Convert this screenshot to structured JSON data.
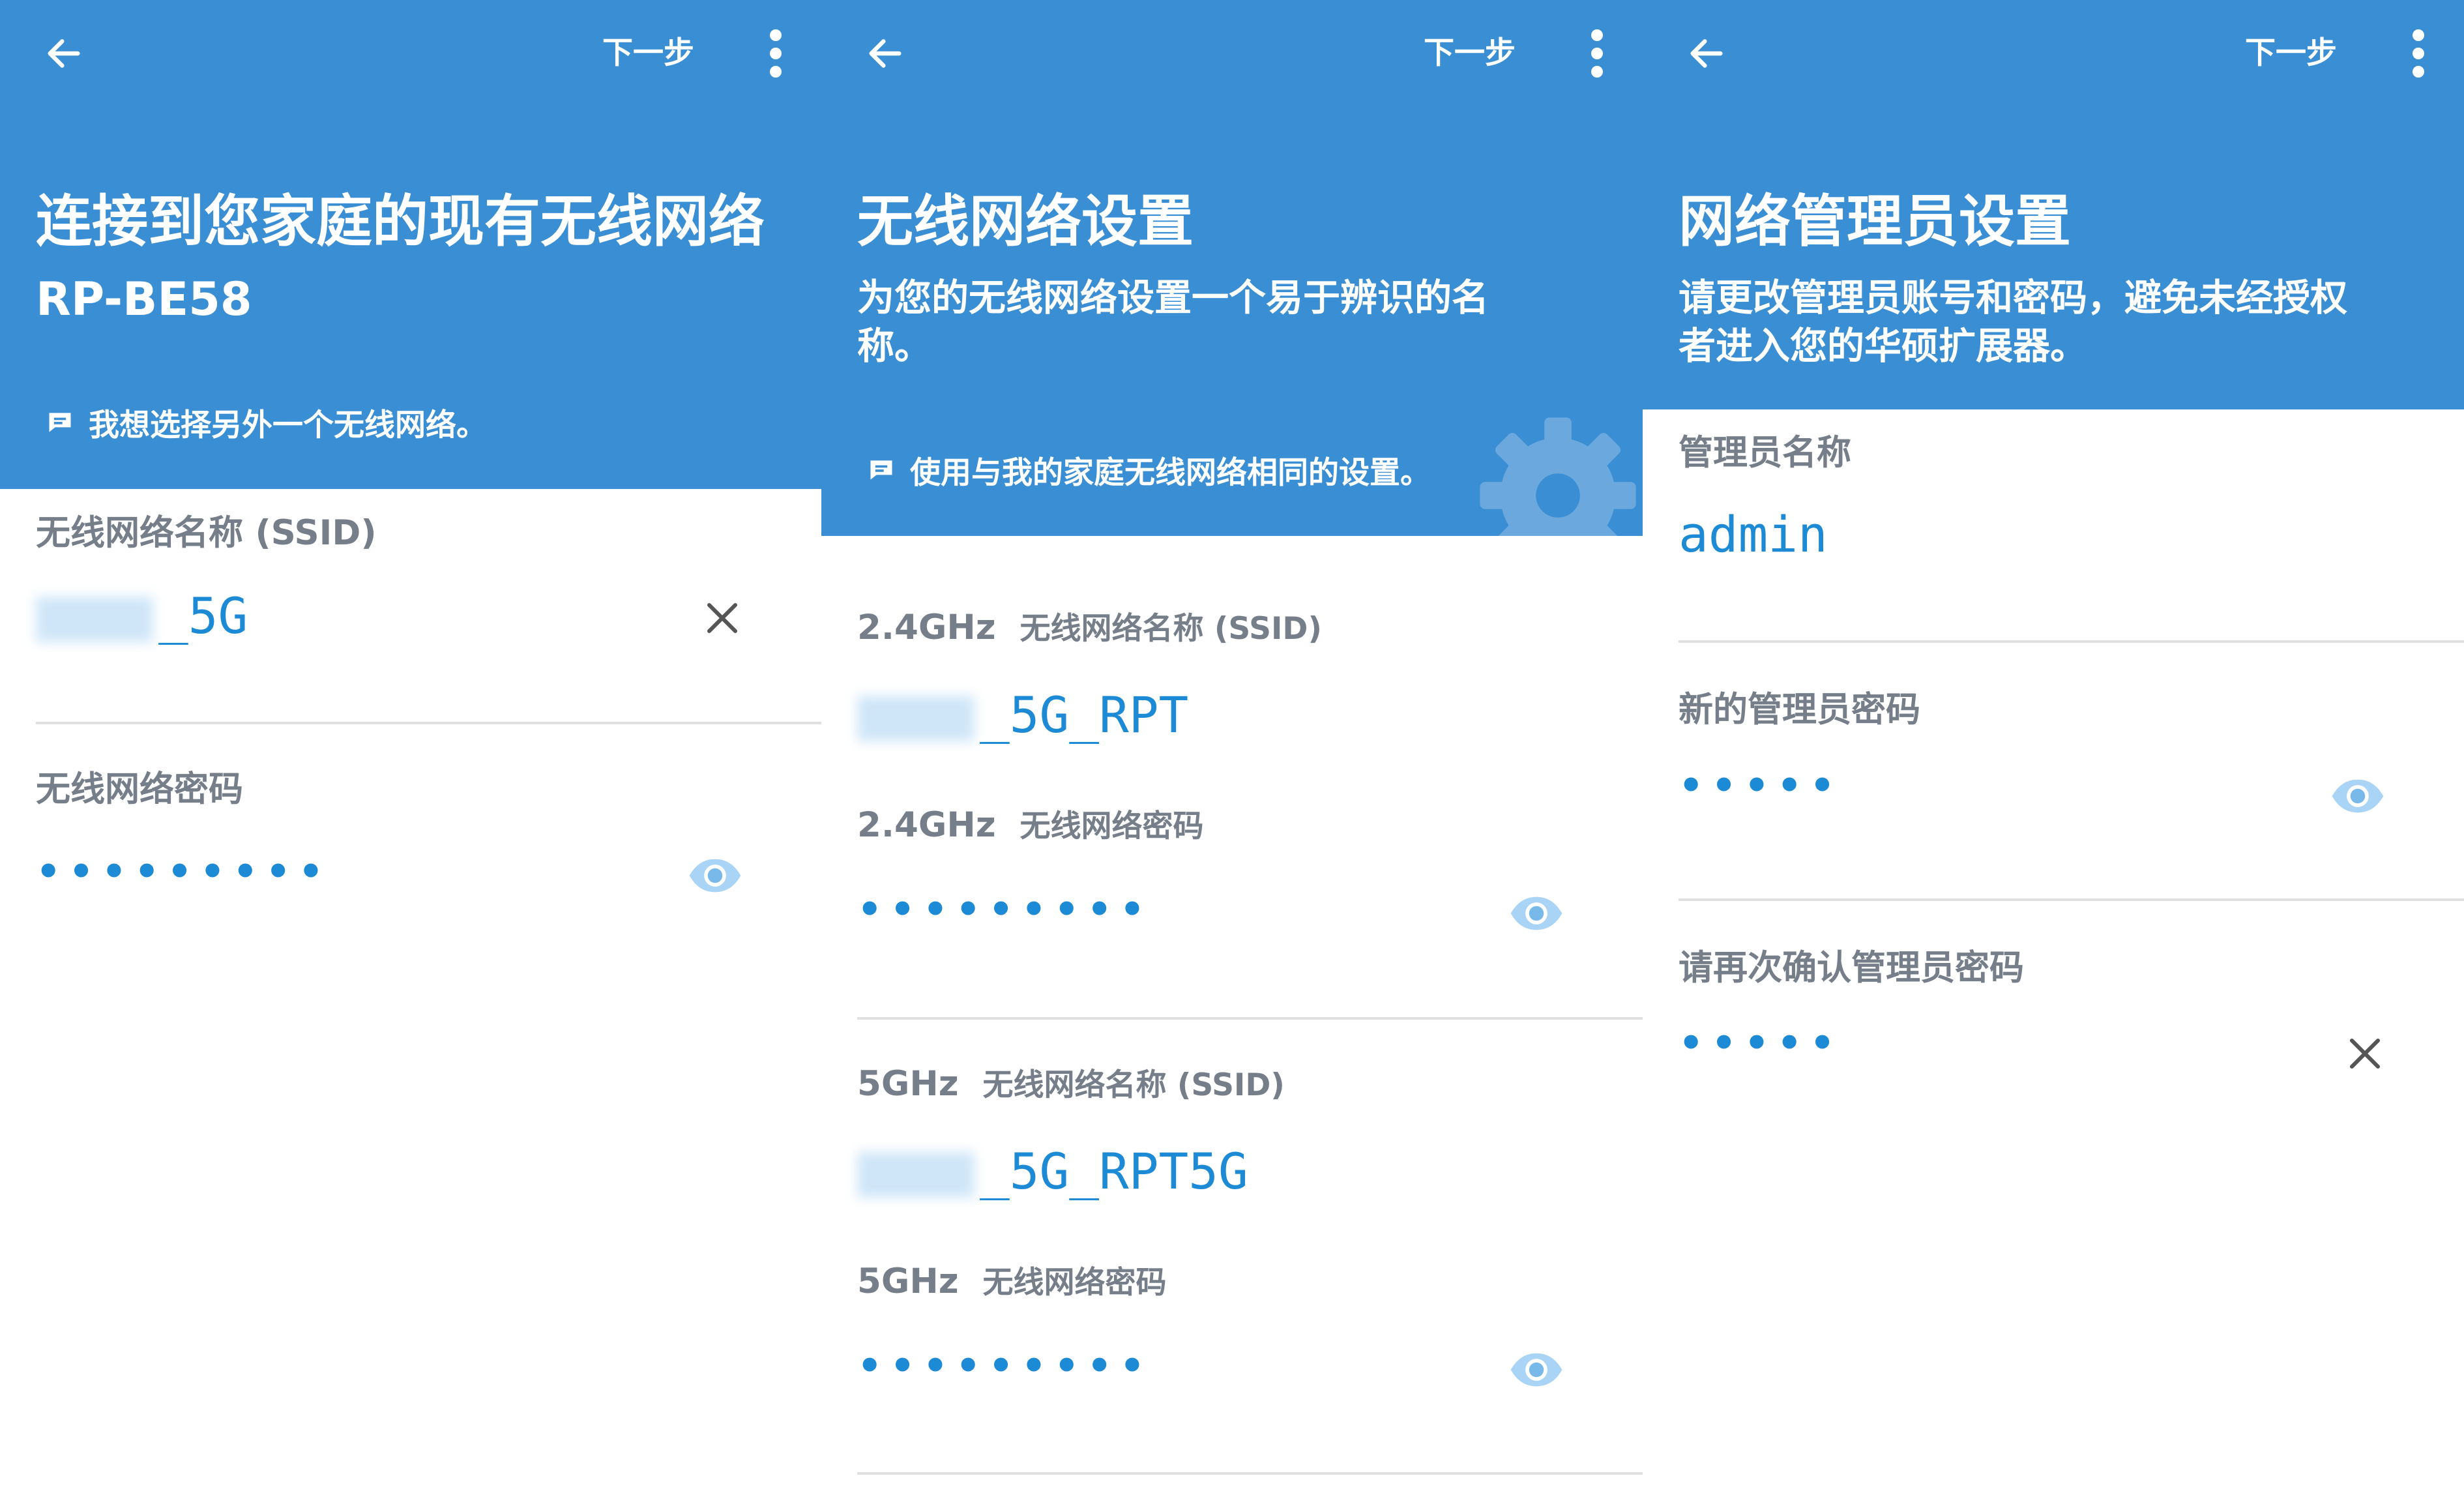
{
  "panels": [
    {
      "next_label": "下一步",
      "title": "连接到您家庭的现有无线网络",
      "subtitle": "RP-BE58",
      "link_text": "我想选择另外一个无线网络。",
      "ssid_label": "无线网络名称 (SSID)",
      "ssid_value": "_5G",
      "password_label": "无线网络密码",
      "password_mask": "•••••••••"
    },
    {
      "next_label": "下一步",
      "title": "无线网络设置",
      "subtitle_line1": "为您的无线网络设置一个易于辨识的名",
      "subtitle_line2": "称。",
      "link_text": "使用与我的家庭无线网络相同的设置。",
      "band24": "2.4GHz",
      "band5": "5GHz",
      "ssid_label": "无线网络名称 (SSID)",
      "password_label": "无线网络密码",
      "ssid24_value": "_5G_RPT",
      "ssid5_value": "_5G_RPT5G",
      "password_mask": "•••••••••"
    },
    {
      "next_label": "下一步",
      "title": "网络管理员设置",
      "subtitle_line1": "请更改管理员账号和密码，避免未经授权",
      "subtitle_line2": "者进入您的华硕扩展器。",
      "admin_label": "管理员名称",
      "admin_value": "admin",
      "new_pw_label": "新的管理员密码",
      "confirm_pw_label": "请再次确认管理员密码",
      "password_mask": "•••••"
    }
  ],
  "colors": {
    "header_blue": "#3a8ed4",
    "value_blue": "#1d8ad6",
    "label_gray": "#767f89",
    "divider": "#e0e0e0"
  },
  "icons": [
    "back-arrow-icon",
    "more-vert-icon",
    "chat-bubble-icon",
    "close-icon",
    "eye-icon",
    "gear-icon"
  ]
}
